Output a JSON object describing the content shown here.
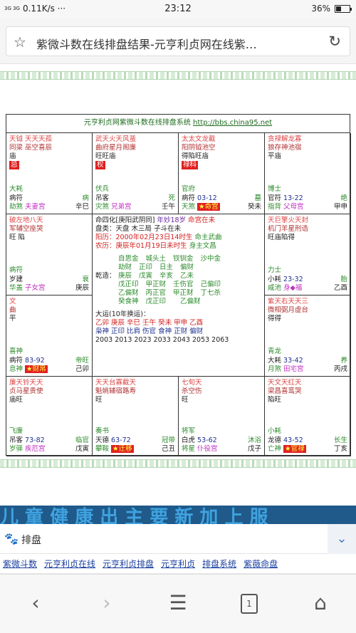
{
  "status": {
    "signal": "3G 3G",
    "speed": "0.11K/s ···",
    "time": "23:12",
    "battery": "36%",
    "battery_level": 0.36
  },
  "browser": {
    "title": "紫微斗数在线排盘结果-元亨利贞网在线紫…",
    "star_icon": "star-icon",
    "reload_icon": "reload-icon"
  },
  "chart": {
    "header_text": "元亨利贞网紫微斗数在线排盘系统 ",
    "header_url": "http://bbs.china95.net",
    "palaces": [
      {
        "stars": "天钺 天天天孤",
        "stars2": "同梁 巫空喜辰",
        "sub": "庙",
        "badge": "忌",
        "lifestar": "大耗",
        "misc": "病符",
        "zhe": "病",
        "footer_a": "劫煞",
        "footer_b": "夫妻宫",
        "footer_c": "辛巳"
      },
      {
        "stars": "武天火天风蜚",
        "stars2": "曲府星月阁廉",
        "sub": "旺旺庙",
        "badge": "权",
        "lifestar": "伏兵",
        "misc": "吊客",
        "zhe": "死",
        "footer_a": "灾煞",
        "footer_b": "兄弟宫",
        "footer_c": "壬午"
      },
      {
        "stars": "太太文龙截",
        "stars2": "阳阴钺池空",
        "sub": "得陷旺庙",
        "badge": "禄科",
        "lifestar": "官府",
        "misc": "病符",
        "range": "03-12",
        "zhe": "墓",
        "footer_a": "天煞",
        "footer_b": "★命宫",
        "footer_c": "癸未"
      },
      {
        "stars": "贪禄解龙寡",
        "stars2": "狼存神池宿",
        "sub": "平庙",
        "badge": "",
        "lifestar": "博士",
        "misc": "官符",
        "range": "13-22",
        "zhe": "绝",
        "footer_a": "指背",
        "footer_b": "父母宫",
        "footer_c": "甲申"
      },
      {
        "stars": "破左地八天",
        "stars2": "军辅空座哭",
        "sub": "旺 陷",
        "lifestar": "病符",
        "misc": "岁建",
        "zhe": "衰",
        "footer_a": "华盖",
        "footer_b": "子女宫",
        "footer_c": "庚辰"
      },
      {
        "stars": "天巨擎火天封",
        "stars2": "机门羊星刑诰",
        "sub": "旺庙陷得",
        "lifestar": "力士",
        "misc": "小耗",
        "range": "23-32",
        "zhe": "胎",
        "footer_a": "咸池",
        "footer_b": "身◆福",
        "footer_c": "乙酉"
      },
      {
        "stars": "文",
        "stars2": "曲",
        "sub": "平",
        "lifestar": "喜神",
        "misc": "病符",
        "range": "83-92",
        "zhe": "帝旺",
        "footer_a": "息神",
        "footer_b": "★财帛",
        "footer_c": "己卯"
      },
      {
        "stars": "紫天右天天三",
        "stars2": "微相弼月虚台",
        "sub": "得得",
        "lifestar": "青龙",
        "misc": "大耗",
        "range": "33-42",
        "zhe": "养",
        "footer_a": "月煞",
        "footer_b": "田宅宫",
        "footer_c": "丙戌"
      },
      {
        "stars": "廉天铃天天",
        "stars2": "贞马星贵使",
        "sub": "庙旺",
        "lifestar": "飞廉",
        "misc": "吊客",
        "range": "73-82",
        "zhe": "临官",
        "footer_a": "岁驿",
        "footer_b": "疾厄宫",
        "footer_c": "戊寅"
      },
      {
        "stars": "天天台寡截天",
        "stars2": "魁姚辅宿路寿",
        "sub": "旺",
        "lifestar": "奏书",
        "misc": "天德",
        "range": "63-72",
        "zhe": "冠带",
        "footer_a": "攀鞍",
        "footer_b": "★迁移",
        "footer_c": "己丑"
      },
      {
        "stars": "七旬天",
        "stars2": "杀空伤",
        "sub": "旺",
        "lifestar": "将军",
        "misc": "白虎",
        "range": "53-62",
        "zhe": "沐浴",
        "footer_a": "将星",
        "footer_b": "仆役宫",
        "footer_c": "戊子"
      },
      {
        "stars": "天文天红天",
        "stars2": "梁昌喜鸾哭",
        "sub": "陷旺",
        "lifestar": "小耗",
        "misc": "龙德",
        "range": "43-52",
        "zhe": "长生",
        "footer_a": "亡神",
        "footer_b": "★官禄",
        "footer_c": "丁亥"
      }
    ],
    "center": {
      "line1": "命四化[庚阳武阴同]",
      "line1b": "年妙18岁",
      "line1c": "命宫在未",
      "line2": "盘类：天盘",
      "line2b": "木三局",
      "line2c": "子斗在未",
      "line3": "阳历：2000年02月23日14时生",
      "line3b": "命主武曲",
      "line4": "农历：庚辰年01月19日未时生",
      "line4b": "身主文昌",
      "pillar_heads": [
        "自思金",
        "城头土",
        "钗钏金",
        "沙中金"
      ],
      "pillar_gods": [
        "劫财",
        "正印",
        "日主",
        "偏财"
      ],
      "qianzao": "乾造：",
      "pillar_stems": [
        "庚辰",
        "戊寅",
        "辛亥",
        "乙未"
      ],
      "pillar_b1": [
        "戊正印",
        "甲正财",
        "壬伤官",
        "己偏印"
      ],
      "pillar_b2": [
        "乙偏财",
        "丙正官",
        "甲正财",
        "丁七杀"
      ],
      "pillar_b3": [
        "癸食神",
        "戊正印",
        "",
        "乙偏财"
      ],
      "pillar_b4": [
        "",
        "",
        "",
        "丁七杀"
      ]
    },
    "dayun_title": "大运(10年换运)：",
    "dayun_stems": "乙卯 庚辰 辛巳 壬午 癸未 甲申 乙酉",
    "dayun_gods": "枭神 正印 比肩 伤官 食神 正财 偏财",
    "dayun_years": "2003 2013 2023 2033 2043 2053 2063"
  },
  "search": {
    "keyword": "排盘",
    "paw_icon": "baidu-paw-icon",
    "links": [
      "紫微斗数",
      "元亨利贞在线",
      "元亨利贞排盘",
      "元亨利贞",
      "排盘系统",
      "紫薇命盘"
    ]
  },
  "nav": {
    "back": "‹",
    "forward": "›",
    "menu": "☰",
    "tabs": "1",
    "home": "⌂"
  },
  "banner_text": "儿 童 健 康 出 主 要 新 加 上 服"
}
